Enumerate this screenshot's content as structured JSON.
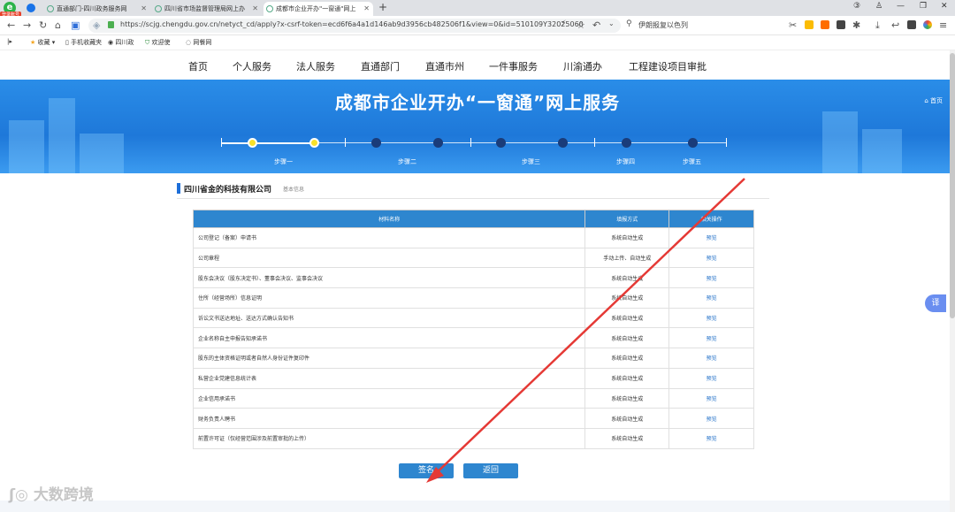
{
  "browser": {
    "login_badge": "登录账号",
    "tabs": [
      {
        "label": "直通部门-四川政务服务网"
      },
      {
        "label": "四川省市场监督管理局网上办"
      },
      {
        "label": "成都市企业开办\"一窗通\"网上"
      }
    ],
    "url": "https://scjg.chengdu.gov.cn/netyct_cd/apply?x-csrf-token=ecd6f6a4a1d146ab9d3956cb482506f1&view=0&id=510109Y32025060",
    "search_text": "伊朗报复以色列",
    "bookmarks": [
      "收藏",
      "手机收藏夹",
      "四川政",
      "欢迎使",
      "网餐网"
    ]
  },
  "mainnav": [
    "首页",
    "个人服务",
    "法人服务",
    "直通部门",
    "直通市州",
    "一件事服务",
    "川渝通办",
    "工程建设项目审批"
  ],
  "banner": {
    "title": "成都市企业开办“一窗通”网上服务",
    "home": "首页"
  },
  "steps": [
    "步骤一",
    "步骤二",
    "步骤三",
    "步骤四",
    "步骤五"
  ],
  "section": {
    "company": "四川省金的科技有限公司",
    "subtitle": "基本信息"
  },
  "table": {
    "headers": [
      "材料名称",
      "填报方式",
      "相关操作"
    ],
    "rows": [
      {
        "name": "公司登记（备案）申请书",
        "method": "系统自动生成",
        "op": "预览"
      },
      {
        "name": "公司章程",
        "method": "手动上传、自动生成",
        "op": "预览"
      },
      {
        "name": "股东会决议（股东决定书）、董事会决议、监事会决议",
        "method": "系统自动生成",
        "op": "预览"
      },
      {
        "name": "住所（经营场所）信息证明",
        "method": "系统自动生成",
        "op": "预览"
      },
      {
        "name": "诉讼文书送达地址、送达方式确认告知书",
        "method": "系统自动生成",
        "op": "预览"
      },
      {
        "name": "企业名称自主申报告知承诺书",
        "method": "系统自动生成",
        "op": "预览"
      },
      {
        "name": "股东的主体资格证明或者自然人身份证件复印件",
        "method": "系统自动生成",
        "op": "预览"
      },
      {
        "name": "私营企业党建信息统计表",
        "method": "系统自动生成",
        "op": "预览"
      },
      {
        "name": "企业信用承诺书",
        "method": "系统自动生成",
        "op": "预览"
      },
      {
        "name": "财务负责人聘书",
        "method": "系统自动生成",
        "op": "预览"
      },
      {
        "name": "前置许可证（仅经营范围涉及前置审批的上传）",
        "method": "系统自动生成",
        "op": "预览"
      }
    ]
  },
  "buttons": {
    "sign": "签名",
    "back": "返回"
  },
  "translate": "译",
  "watermark": "大数跨境"
}
